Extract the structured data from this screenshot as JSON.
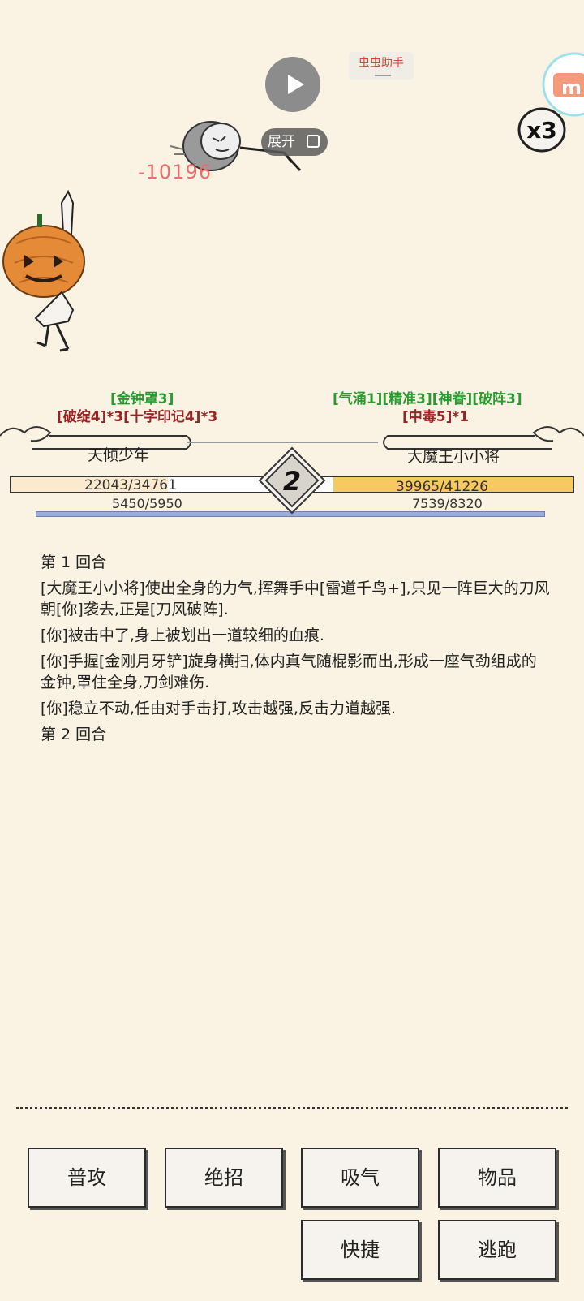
{
  "overlay": {
    "helper_label": "虫虫助手",
    "expand_label": "展开",
    "speed_label": "x3"
  },
  "battle": {
    "damage_popup": "-10196",
    "turn_number": "2",
    "player": {
      "name": "天倾少年",
      "buffs": "[金钟罩3]",
      "debuffs": "[破绽4]*3[十字印记4]*3",
      "hp": "22043/34761",
      "mp": "5450/5950",
      "hp_fraction": 0.634,
      "mp_fraction": 0.916
    },
    "enemy": {
      "name": "大魔王小小将",
      "buffs": "[气涌1][精准3][神眷][破阵3]",
      "debuffs": "[中毒5]*1",
      "hp": "39965/41226",
      "mp": "7539/8320",
      "hp_fraction": 0.969,
      "mp_fraction": 0.906
    }
  },
  "log": [
    "第 1 回合",
    "[大魔王小小将]使出全身的力气,挥舞手中[雷道千鸟+],只见一阵巨大的刀风朝[你]袭去,正是[刀风破阵].",
    "[你]被击中了,身上被划出一道较细的血痕.",
    "[你]手握[金刚月牙铲]旋身横扫,体内真气随棍影而出,形成一座气劲组成的金钟,罩住全身,刀剑难伤.",
    "[你]稳立不动,任由对手击打,攻击越强,反击力道越强.",
    "第 2 回合"
  ],
  "actions": {
    "attack": "普攻",
    "ultimate": "绝招",
    "breathe": "吸气",
    "items": "物品",
    "quick": "快捷",
    "flee": "逃跑"
  },
  "colors": {
    "background": "#faf3e3",
    "buff_green": "#2a9b32",
    "debuff_red": "#9c2323",
    "damage_red": "#ef6b6b",
    "hp_enemy": "#f7c961",
    "mp_blue": "#9aaedc"
  }
}
